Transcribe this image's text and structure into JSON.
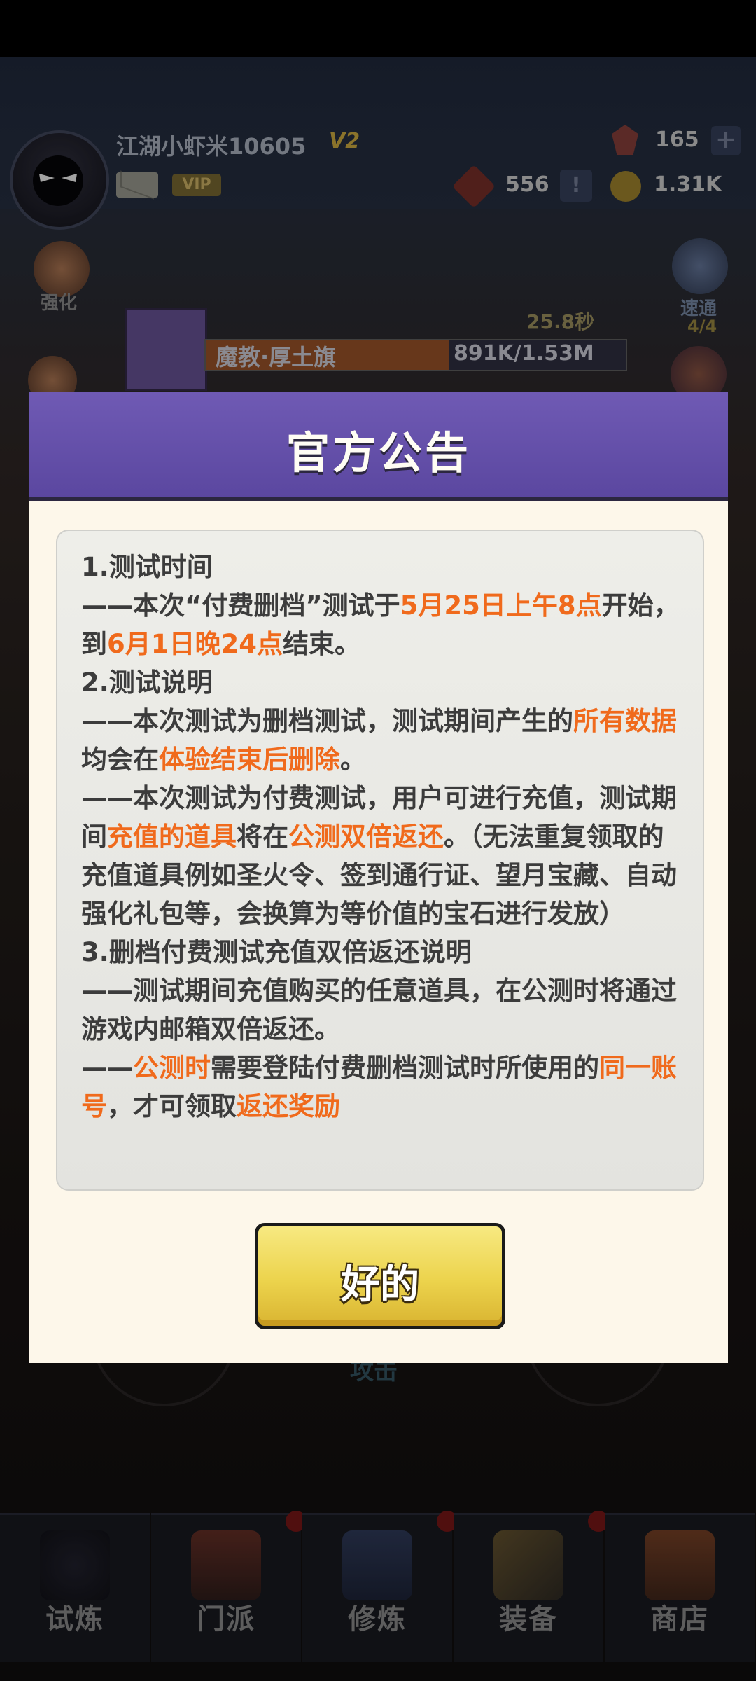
{
  "hud": {
    "player_name": "江湖小虾米10605",
    "vip_level": "V2",
    "vip_label": "VIP",
    "gems": "165",
    "tokens": "556",
    "coins": "1.31K",
    "plus": "+",
    "alert": "!"
  },
  "side": {
    "strengthen": "强化",
    "quick_pass": "速通",
    "quick_pass_count": "4/4"
  },
  "boss": {
    "timer": "25.8秒",
    "name": "魔教·厚土旗",
    "hp": "891K/1.53M",
    "hp_fraction": 0.58
  },
  "attack_label": "攻击",
  "nav": [
    {
      "label": "试炼",
      "badge": false
    },
    {
      "label": "门派",
      "badge": true
    },
    {
      "label": "修炼",
      "badge": true
    },
    {
      "label": "装备",
      "badge": true
    },
    {
      "label": "商店",
      "badge": false
    }
  ],
  "dialog": {
    "title": "官方公告",
    "ok_label": "好的",
    "s1_heading": "1.测试时间",
    "s1_a": "——本次“付费删档”测试于",
    "s1_b": "5月25日上午8点",
    "s1_c": "开始，到",
    "s1_d": "6月1日晚24点",
    "s1_e": "结束。",
    "s2_heading": "2.测试说明",
    "s2_a": "——本次测试为删档测试，测试期间产生的",
    "s2_b": "所有数据",
    "s2_c": "均会在",
    "s2_d": "体验结束后删除",
    "s2_e": "。",
    "s2_f": "——本次测试为付费测试，用户可进行充值，测试期间",
    "s2_g": "充值的道具",
    "s2_h": "将在",
    "s2_i": "公测双倍返还",
    "s2_j": "。（无法重复领取的充值道具例如圣火令、签到通行证、望月宝藏、自动强化礼包等，会换算为等价值的宝石进行发放）",
    "s3_heading": "3.删档付费测试充值双倍返还说明",
    "s3_a": "——测试期间充值购买的任意道具，在公测时将通过游戏内邮箱双倍返还。",
    "s3_b": "——",
    "s3_c": "公测时",
    "s3_d": "需要登陆付费删档测试时所使用的",
    "s3_e": "同一账号",
    "s3_f": "，才可领取",
    "s3_g": "返还奖励"
  },
  "colors": {
    "header_purple": "#6a55ad",
    "highlight_orange": "#f06a1c",
    "button_yellow": "#ecd34c",
    "dialog_bg": "#fdf7ea"
  }
}
